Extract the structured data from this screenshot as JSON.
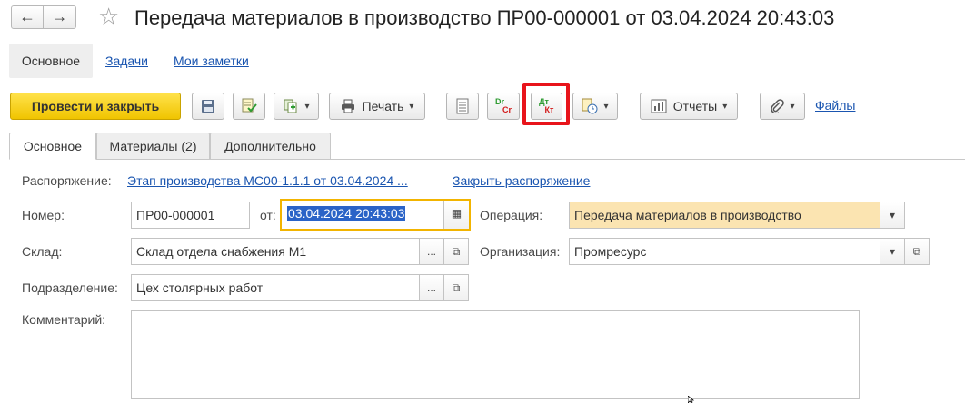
{
  "window": {
    "title": "Передача материалов в производство ПР00-000001 от 03.04.2024 20:43:03",
    "back_icon": "←",
    "forward_icon": "→",
    "favorite_icon": "☆"
  },
  "sections": {
    "main": "Основное",
    "tasks": "Задачи",
    "notes": "Мои заметки"
  },
  "toolbar": {
    "post_close": "Провести и закрыть",
    "print": "Печать",
    "reports": "Отчеты",
    "files": "Файлы",
    "drcr_top": "Dr",
    "drcr_bottom": "Cr",
    "dtkt_top": "Дт",
    "dtkt_bottom": "Кт",
    "caret": "▾"
  },
  "tabs": [
    {
      "label": "Основное",
      "active": true
    },
    {
      "label": "Материалы (2)",
      "active": false
    },
    {
      "label": "Дополнительно",
      "active": false
    }
  ],
  "form": {
    "order_label": "Распоряжение:",
    "order_link": "Этап производства МС00-1.1.1 от 03.04.2024 ...",
    "close_order_link": "Закрыть распоряжение",
    "number_label": "Номер:",
    "number_value": "ПР00-000001",
    "date_label": "от:",
    "date_value": "03.04.2024 20:43:03",
    "operation_label": "Операция:",
    "operation_value": "Передача материалов в производство",
    "warehouse_label": "Склад:",
    "warehouse_value": "Склад отдела снабжения М1",
    "organization_label": "Организация:",
    "organization_value": "Промресурс",
    "department_label": "Подразделение:",
    "department_value": "Цех столярных работ",
    "comment_label": "Комментарий:",
    "comment_value": "",
    "select_btn": "...",
    "open_btn": "⧉",
    "dropdown_btn": "▾",
    "calendar_btn": "▦"
  },
  "colors": {
    "primary_button": "#f0c400",
    "link": "#1a55b0",
    "highlight": "#e8141b",
    "focus": "#f2b400",
    "operation_bg": "#fbe4b1"
  }
}
